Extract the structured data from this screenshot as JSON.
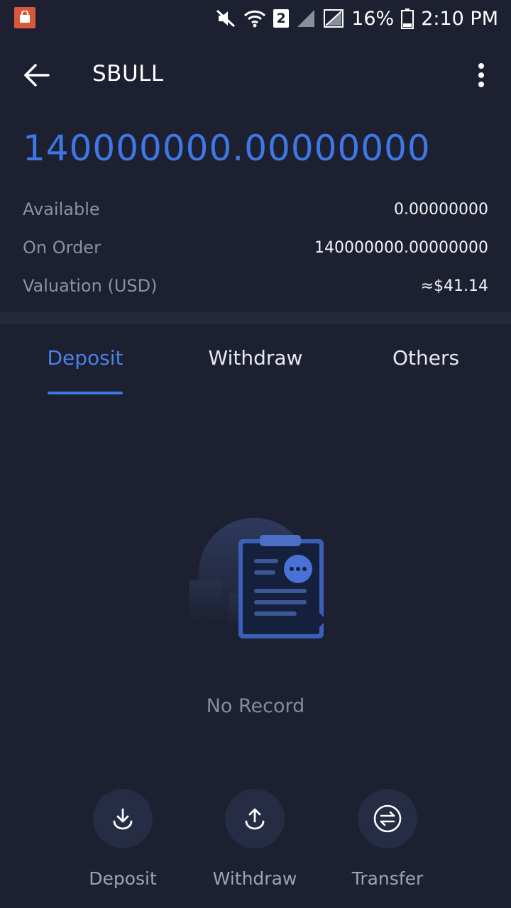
{
  "status_bar": {
    "battery": "16%",
    "time": "2:10 PM",
    "sim_slot": "2",
    "icons": [
      "app-notification-icon",
      "mute-icon",
      "wifi-icon",
      "sim-icon",
      "signal-icon",
      "no-signal-icon",
      "battery-icon"
    ]
  },
  "header": {
    "title": "SBULL",
    "icons": [
      "back-arrow-icon",
      "more-vertical-icon"
    ]
  },
  "balance": {
    "total": "140000000.00000000",
    "rows": [
      {
        "label": "Available",
        "value": "0.00000000"
      },
      {
        "label": "On Order",
        "value": "140000000.00000000"
      },
      {
        "label": "Valuation (USD)",
        "value": "≈$41.14"
      }
    ]
  },
  "tabs": [
    {
      "label": "Deposit",
      "active": true
    },
    {
      "label": "Withdraw",
      "active": false
    },
    {
      "label": "Others",
      "active": false
    }
  ],
  "empty_state": {
    "text": "No Record",
    "icon": "empty-clipboard-icon"
  },
  "actions": [
    {
      "label": "Deposit",
      "icon": "download-icon"
    },
    {
      "label": "Withdraw",
      "icon": "upload-icon"
    },
    {
      "label": "Transfer",
      "icon": "transfer-icon"
    }
  ],
  "colors": {
    "background": "#1c2030",
    "accent": "#3f77e6",
    "muted": "#8b91a2"
  }
}
